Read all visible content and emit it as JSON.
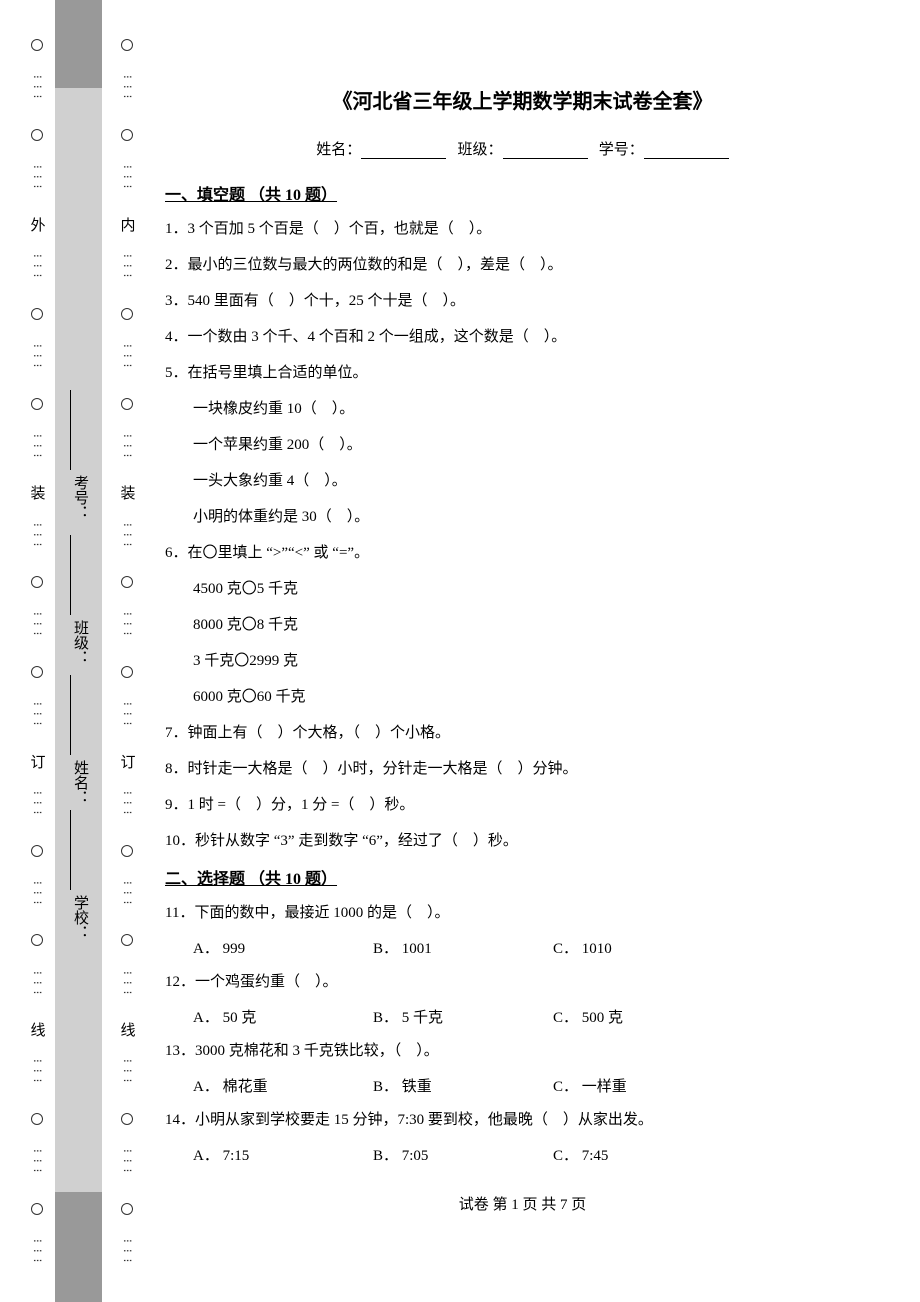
{
  "title": "《河北省三年级上学期数学期末试卷全套》",
  "info": {
    "name_label": "姓名：",
    "class_label": "班级：",
    "id_label": "学号："
  },
  "binding": {
    "outer_char": "外",
    "inner_char": "内",
    "zhuang": "装",
    "ding": "订",
    "xian": "线",
    "school": "学校：",
    "name": "姓名：",
    "class": "班级：",
    "examno": "考号："
  },
  "section1": {
    "header": "一、填空题 （共 10 题）",
    "q1": "1．3 个百加 5 个百是（　）个百，也就是（　）。",
    "q2": "2．最小的三位数与最大的两位数的和是（　），差是（　）。",
    "q3": "3．540 里面有（　）个十，25 个十是（　）。",
    "q4": "4．一个数由 3 个千、4 个百和 2 个一组成，这个数是（　）。",
    "q5": "5．在括号里填上合适的单位。",
    "q5a": "一块橡皮约重 10（　）。",
    "q5b": "一个苹果约重 200（　）。",
    "q5c": "一头大象约重 4（　）。",
    "q5d": "小明的体重约是 30（　）。",
    "q6": "6．在〇里填上 “>”“<” 或 “=”。",
    "q6a": "4500 克〇5 千克",
    "q6b": "8000 克〇8 千克",
    "q6c": "3 千克〇2999 克",
    "q6d": "6000 克〇60 千克",
    "q7": "7．钟面上有（　）个大格，（　）个小格。",
    "q8": "8．时针走一大格是（　）小时，分针走一大格是（　）分钟。",
    "q9": "9．1 时 =（　）分，1 分 =（　）秒。",
    "q10": "10．秒针从数字 “3” 走到数字 “6”，经过了（　）秒。"
  },
  "section2": {
    "header": "二、选择题 （共 10 题）",
    "q11": "11．下面的数中，最接近 1000 的是（　）。",
    "q11a": "A． 999",
    "q11b": "B． 1001",
    "q11c": "C． 1010",
    "q12": "12．一个鸡蛋约重（　）。",
    "q12a": "A． 50 克",
    "q12b": "B． 5 千克",
    "q12c": "C． 500 克",
    "q13": "13．3000 克棉花和 3 千克铁比较，（　）。",
    "q13a": "A． 棉花重",
    "q13b": "B． 铁重",
    "q13c": "C． 一样重",
    "q14": "14．小明从家到学校要走 15 分钟，7:30 要到校，他最晚（　）从家出发。",
    "q14a": "A． 7:15",
    "q14b": "B． 7:05",
    "q14c": "C． 7:45"
  },
  "footer": "试卷 第 1 页 共 7 页"
}
